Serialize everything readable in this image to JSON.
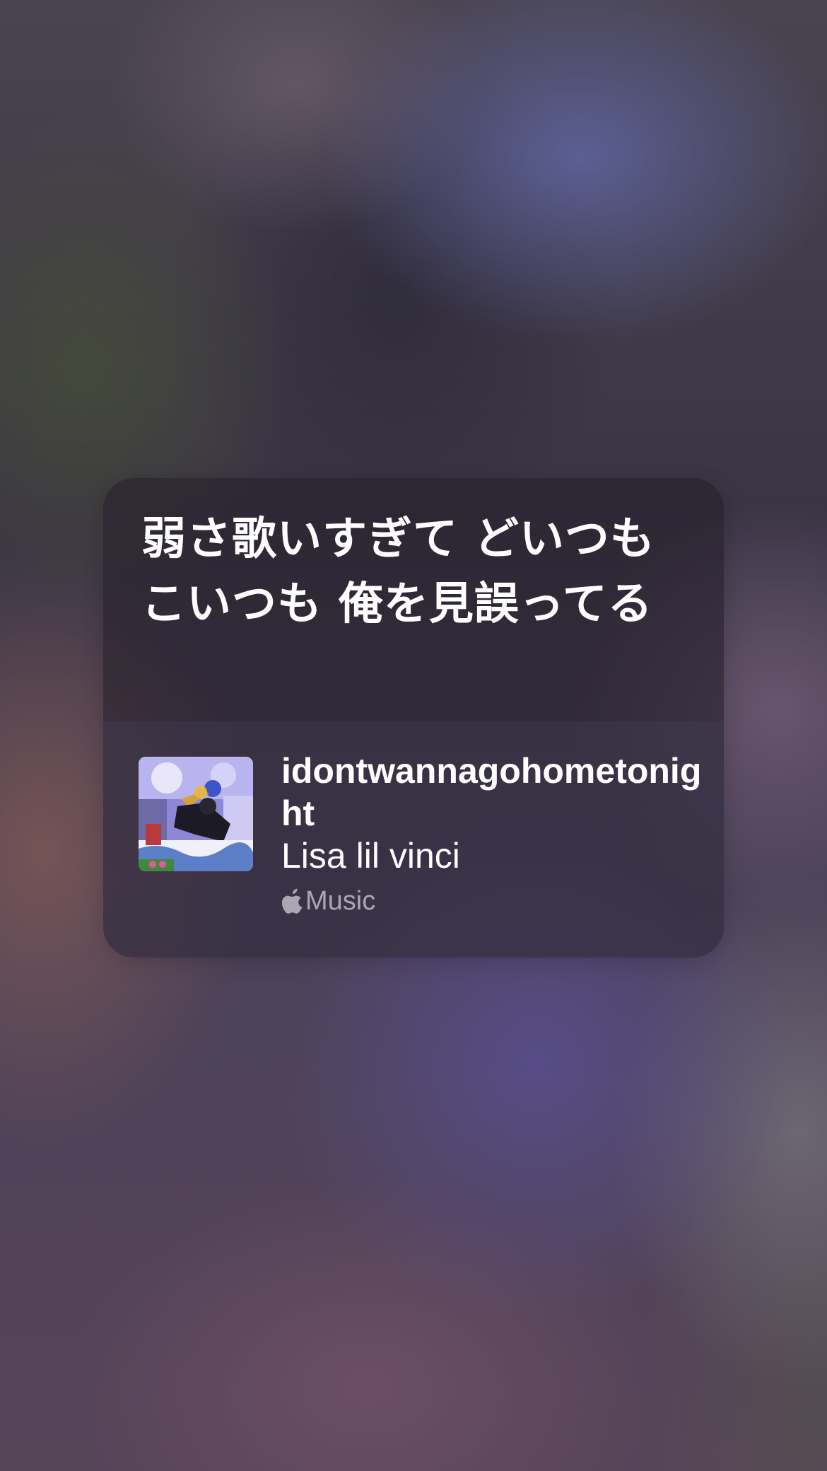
{
  "lyrics_card": {
    "lyric_text": "弱さ歌いすぎて どいつも こいつも 俺を見誤ってる"
  },
  "now_playing": {
    "title": "idontwannagohometonight",
    "artist": "Lisa lil vinci",
    "source_label": "Music",
    "source_icon": "apple-logo-icon",
    "artwork_icon": "album-artwork"
  },
  "colors": {
    "card_background": "#26202c",
    "text_primary": "#ffffff",
    "text_secondary": "#c8c3cd"
  }
}
